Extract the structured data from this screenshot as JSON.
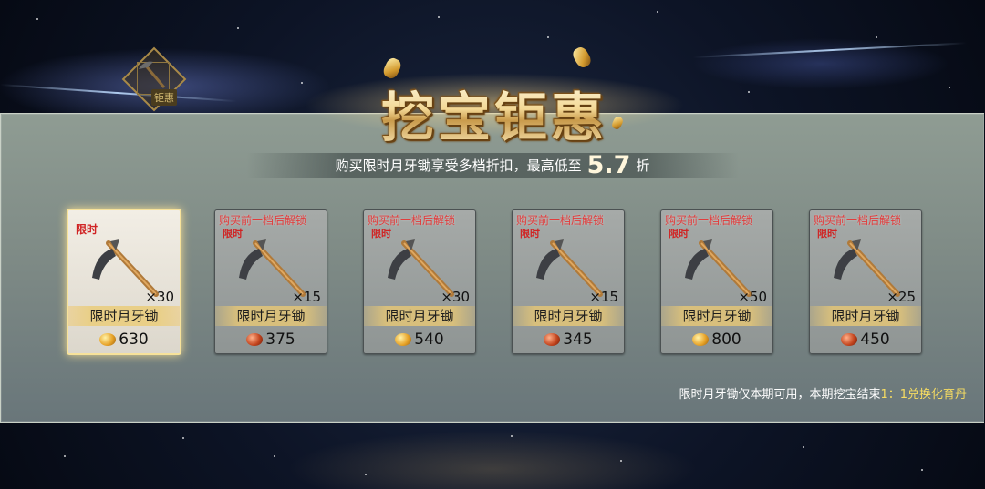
{
  "emblem": {
    "tag": "钜惠",
    "icon": "pickaxe-icon"
  },
  "title": "挖宝钜惠",
  "subtitle": {
    "prefix": "购买限时月牙锄享受多档折扣，最高低至",
    "discount": "5.7",
    "suffix": "折"
  },
  "items": [
    {
      "name": "限时月牙锄",
      "qty": "×30",
      "price": "630",
      "currency": "gold-ingot",
      "lock_text": "",
      "tag": "限时",
      "active": true
    },
    {
      "name": "限时月牙锄",
      "qty": "×15",
      "price": "375",
      "currency": "red-ingot",
      "lock_text": "购买前一档后解锁",
      "tag": "限时",
      "active": false
    },
    {
      "name": "限时月牙锄",
      "qty": "×30",
      "price": "540",
      "currency": "gold-ingot",
      "lock_text": "购买前一档后解锁",
      "tag": "限时",
      "active": false
    },
    {
      "name": "限时月牙锄",
      "qty": "×15",
      "price": "345",
      "currency": "red-ingot",
      "lock_text": "购买前一档后解锁",
      "tag": "限时",
      "active": false
    },
    {
      "name": "限时月牙锄",
      "qty": "×50",
      "price": "800",
      "currency": "gold-ingot",
      "lock_text": "购买前一档后解锁",
      "tag": "限时",
      "active": false
    },
    {
      "name": "限时月牙锄",
      "qty": "×25",
      "price": "450",
      "currency": "red-ingot",
      "lock_text": "购买前一档后解锁",
      "tag": "限时",
      "active": false
    }
  ],
  "footnote": {
    "main": "限时月牙锄仅本期可用，本期挖宝结束",
    "highlight": "1：1兑换化育丹"
  },
  "colors": {
    "highlight": "#f6dc62",
    "lock": "#e23b3b",
    "active_border": "#f7e29a"
  }
}
